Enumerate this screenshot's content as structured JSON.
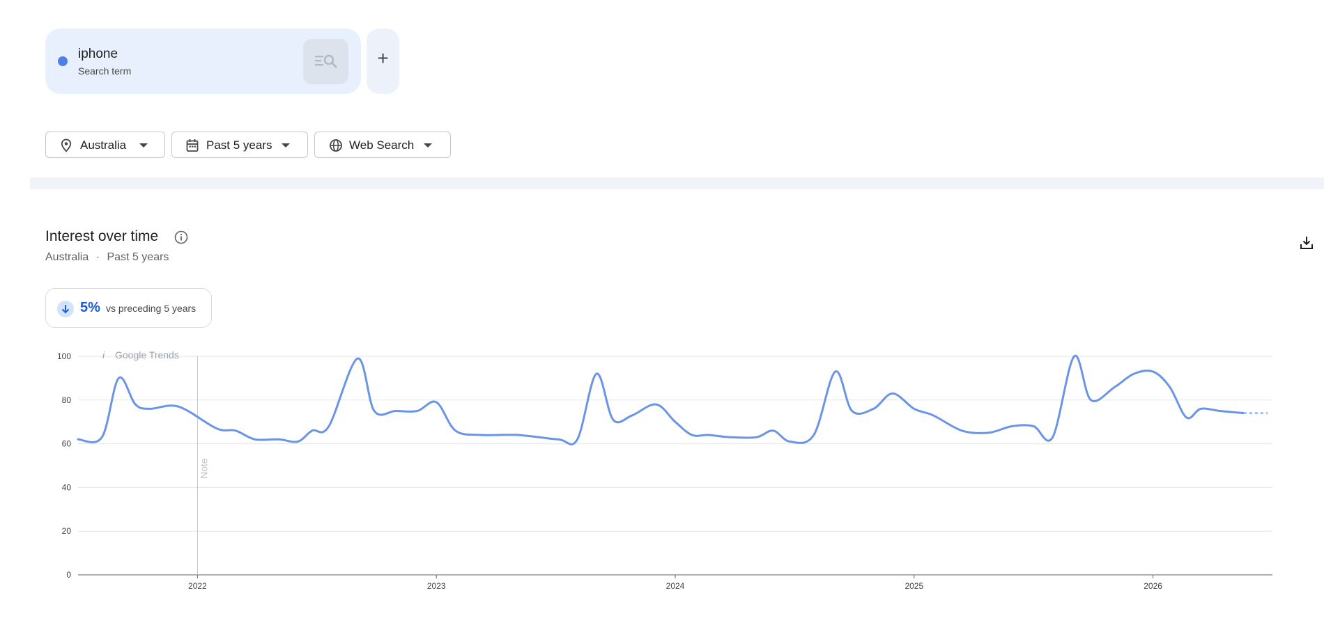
{
  "term": {
    "name": "iphone",
    "subtitle": "Search term",
    "color": "#4f7fe6",
    "add_label": "+"
  },
  "filters": [
    {
      "icon": "location-pin-icon",
      "label": "Australia"
    },
    {
      "icon": "calendar-icon",
      "label": "Past 5 years"
    },
    {
      "icon": "globe-icon",
      "label": "Web Search"
    }
  ],
  "chart_header": {
    "title": "Interest over time",
    "location": "Australia",
    "separator": "·",
    "period": "Past 5 years"
  },
  "stat": {
    "direction": "down",
    "value": "5%",
    "label": "vs preceding 5 years"
  },
  "chart_data": {
    "type": "line",
    "watermark_icon": "i",
    "watermark": "Google Trends",
    "note_label": "Note",
    "note_at": 2022.0,
    "y_ticks": [
      "100",
      "80",
      "60",
      "40",
      "20",
      "0"
    ],
    "ylim": [
      0,
      100
    ],
    "x_ticks": [
      "2022",
      "2023",
      "2024",
      "2025",
      "2026"
    ],
    "xlim": [
      2021.5,
      2026.5
    ],
    "grid": true,
    "line_color": "#6a94e6",
    "series": [
      {
        "x": [
          2021.5,
          2021.6,
          2021.67,
          2021.74,
          2021.8,
          2021.92,
          2022.08,
          2022.16,
          2022.24,
          2022.34,
          2022.42,
          2022.48,
          2022.55,
          2022.67,
          2022.74,
          2022.83,
          2022.92,
          2023.0,
          2023.08,
          2023.19,
          2023.34,
          2023.51,
          2023.59,
          2023.67,
          2023.74,
          2023.82,
          2023.92,
          2024.0,
          2024.07,
          2024.14,
          2024.23,
          2024.34,
          2024.41,
          2024.48,
          2024.58,
          2024.67,
          2024.74,
          2024.83,
          2024.91,
          2025.0,
          2025.08,
          2025.2,
          2025.31,
          2025.41,
          2025.5,
          2025.58,
          2025.67,
          2025.74,
          2025.84,
          2025.92,
          2026.0,
          2026.07,
          2026.14,
          2026.2,
          2026.28,
          2026.38
        ],
        "y": [
          62,
          63,
          90,
          78,
          76,
          77,
          67,
          66,
          62,
          62,
          61,
          66,
          68,
          99,
          75,
          75,
          75,
          79,
          66,
          64,
          64,
          62,
          62,
          92,
          71,
          73,
          78,
          70,
          64,
          64,
          63,
          63,
          66,
          61,
          64,
          93,
          75,
          76,
          83,
          76,
          73,
          66,
          65,
          68,
          68,
          63,
          100,
          80,
          86,
          92,
          93,
          86,
          72,
          76,
          75,
          74
        ]
      }
    ],
    "partial_from": 2026.38,
    "partial_to": 2026.48,
    "partial_value": 74
  }
}
